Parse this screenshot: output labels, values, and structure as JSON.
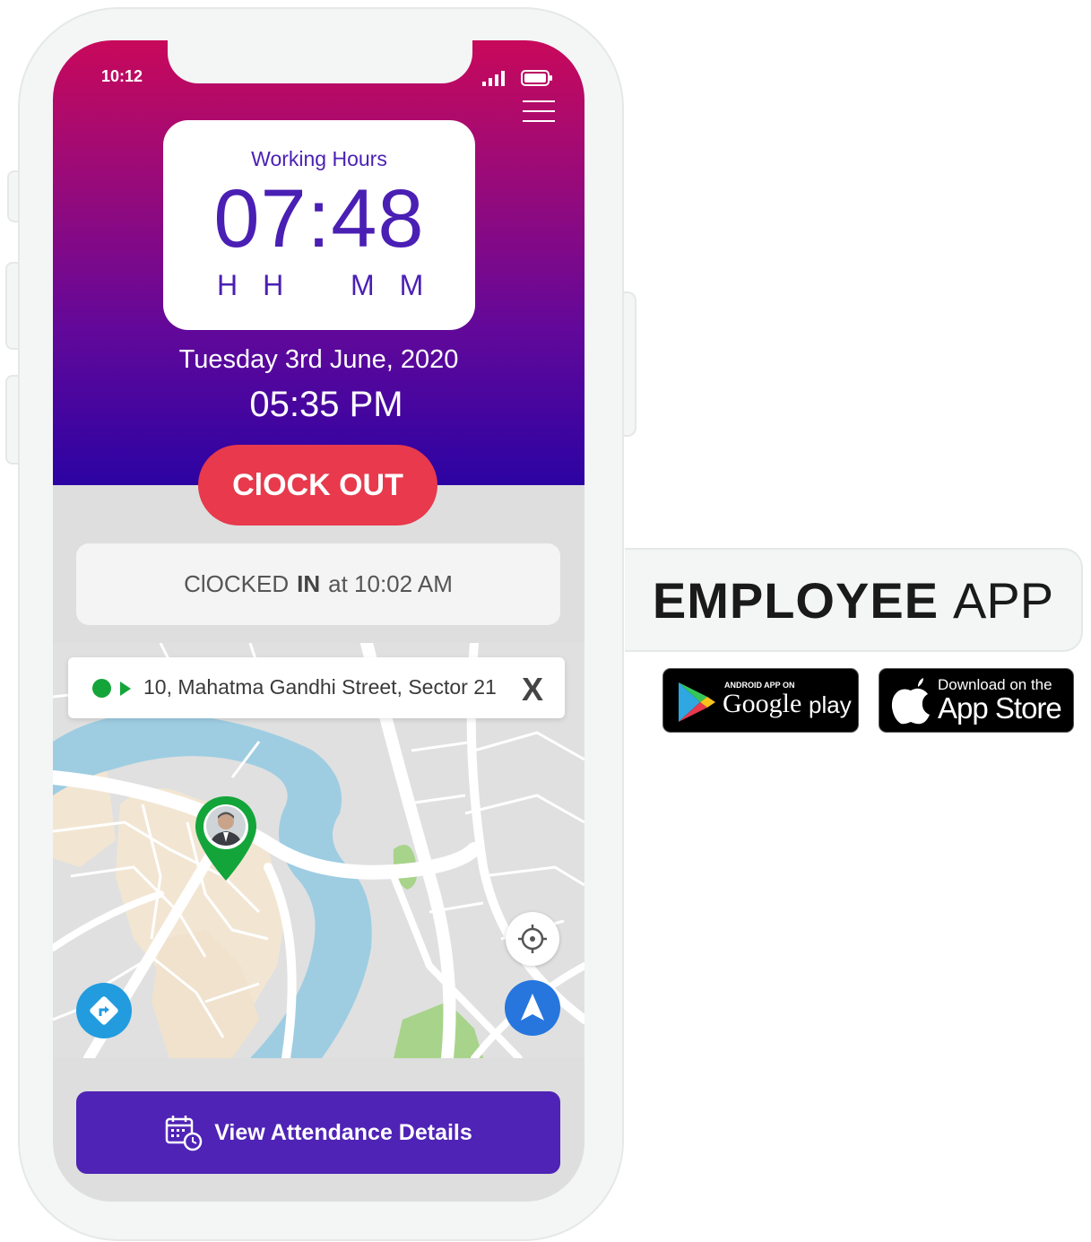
{
  "status_bar": {
    "time": "10:12"
  },
  "working_hours": {
    "label": "Working Hours",
    "value": "07:48",
    "unit_hours": "HH",
    "unit_minutes": "MM"
  },
  "date": "Tuesday 3rd June, 2020",
  "current_time": "05:35 PM",
  "clock_out_button": "ClOCK OUT",
  "clocked_in": {
    "prefix": "ClOCKED",
    "status": "IN",
    "suffix": "at 10:02 AM"
  },
  "address": "10, Mahatma Gandhi Street, Sector 21",
  "close_symbol": "X",
  "attendance_button": "View Attendance Details",
  "brand": {
    "title_bold": "EMPLOYEE",
    "title_regular": "APP"
  },
  "google_badge": {
    "small": "ANDROID APP ON",
    "google": "Google",
    "play": "play"
  },
  "apple_badge": {
    "small": "Download on the",
    "large": "App Store"
  },
  "colors": {
    "header_top": "#c8095b",
    "header_bottom": "#2c03a3",
    "clock_out": "#e8394d",
    "accent_purple": "#4f23b5",
    "pin_green": "#14a53a",
    "nav_blue": "#2676de"
  },
  "icons": [
    "signal-icon",
    "battery-icon",
    "menu-icon",
    "location-pin-icon",
    "locate-icon",
    "navigation-arrow-icon",
    "directions-icon",
    "calendar-clock-icon",
    "google-play-icon",
    "apple-icon",
    "close-icon"
  ]
}
